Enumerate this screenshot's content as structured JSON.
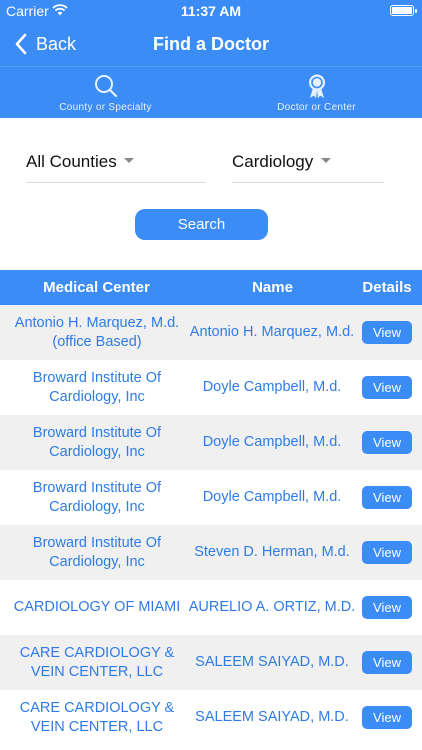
{
  "status_bar": {
    "carrier": "Carrier",
    "time": "11:37 AM"
  },
  "nav": {
    "back_label": "Back",
    "title": "Find a Doctor"
  },
  "tabs": [
    {
      "label": "County or Specialty",
      "icon": "search-icon"
    },
    {
      "label": "Doctor or Center",
      "icon": "award-ribbon-icon"
    }
  ],
  "filters": {
    "county": "All Counties",
    "specialty": "Cardiology",
    "search_label": "Search"
  },
  "table": {
    "headers": {
      "center": "Medical Center",
      "name": "Name",
      "details": "Details"
    },
    "view_label": "View",
    "rows": [
      {
        "center": "Antonio H. Marquez, M.d. (office Based)",
        "name": "Antonio H. Marquez, M.d."
      },
      {
        "center": "Broward Institute Of Cardiology, Inc",
        "name": "Doyle Campbell, M.d."
      },
      {
        "center": "Broward Institute Of Cardiology, Inc",
        "name": "Doyle Campbell, M.d."
      },
      {
        "center": "Broward Institute Of Cardiology, Inc",
        "name": "Doyle Campbell, M.d."
      },
      {
        "center": "Broward Institute Of Cardiology, Inc",
        "name": "Steven D. Herman, M.d."
      },
      {
        "center": "CARDIOLOGY OF MIAMI",
        "name": "AURELIO A. ORTIZ, M.D."
      },
      {
        "center": "CARE CARDIOLOGY & VEIN CENTER, LLC",
        "name": "SALEEM SAIYAD, M.D."
      },
      {
        "center": "CARE CARDIOLOGY & VEIN CENTER, LLC",
        "name": "SALEEM SAIYAD, M.D."
      }
    ]
  },
  "colors": {
    "accent": "#3b8cf5",
    "link_text": "#2f7be6",
    "row_alt": "#f0f0f0"
  }
}
